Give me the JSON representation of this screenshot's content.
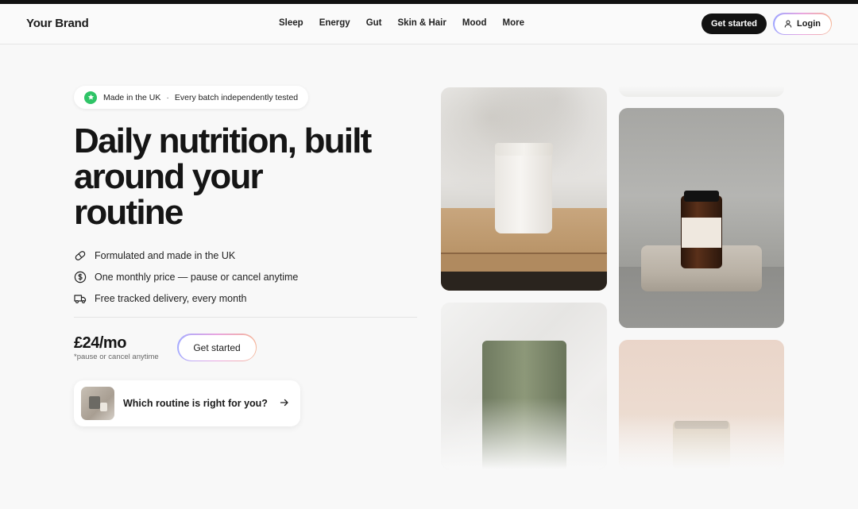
{
  "header": {
    "brand": "Your Brand",
    "nav": [
      "Sleep",
      "Energy",
      "Gut",
      "Skin & Hair",
      "Mood",
      "More"
    ],
    "cta_label": "Get started",
    "login_label": "Login"
  },
  "hero": {
    "badge_part1": "Made in the UK",
    "badge_separator": "·",
    "badge_part2": "Every batch independently tested",
    "headline": "Daily nutrition, built around your routine",
    "features": [
      {
        "icon": "pill-icon",
        "text": "Formulated and made in the UK"
      },
      {
        "icon": "dollar-circle-icon",
        "text": "One monthly price — pause or cancel anytime"
      },
      {
        "icon": "truck-icon",
        "text": "Free tracked delivery, every month"
      }
    ],
    "price": "£24/mo",
    "price_note": "*pause or cancel anytime",
    "cta_label": "Get started",
    "quiz_label": "Which routine is right for you?"
  },
  "colors": {
    "accent_green": "#2fc467",
    "dark_button": "#121212",
    "gradient_border": [
      "#9fa6ff",
      "#e9a6e0",
      "#f5b69a"
    ]
  }
}
